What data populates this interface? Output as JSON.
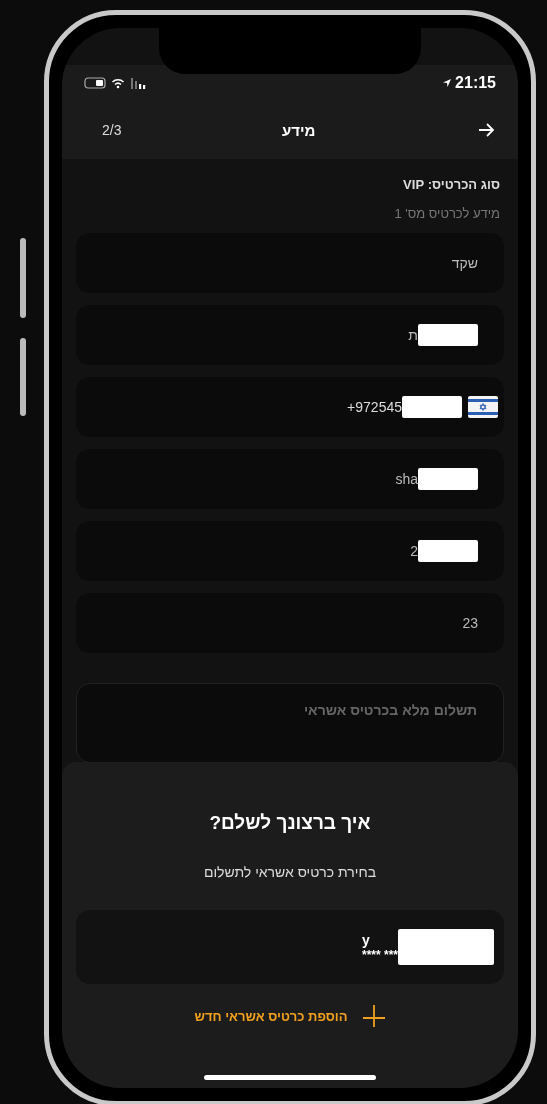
{
  "status_bar": {
    "time": "21:15"
  },
  "header": {
    "title": "מידע",
    "step": "2/3"
  },
  "ticket_type": "סוג הכרטיס: VIP",
  "section_label": "מידע לכרטיס מס' 1",
  "fields": [
    {
      "kind": "text",
      "value": "שקד",
      "redacted": false
    },
    {
      "kind": "text",
      "value": "ת",
      "redacted": true
    },
    {
      "kind": "phone",
      "value": "+972545",
      "redacted": true
    },
    {
      "kind": "text",
      "value": "sha",
      "redacted": true
    },
    {
      "kind": "text",
      "value": "2",
      "redacted": true
    },
    {
      "kind": "text",
      "value": "23",
      "redacted": false
    }
  ],
  "payment_field": {
    "placeholder": "תשלום מלא בכרטיס אשראי"
  },
  "sheet": {
    "title": "איך ברצונך לשלם?",
    "subtitle": "בחירת כרטיס אשראי לתשלום",
    "cards": [
      {
        "holder": "y",
        "number": "**** ***",
        "redacted": true
      }
    ],
    "add_button": "הוספת כרטיס אשראי חדש"
  }
}
